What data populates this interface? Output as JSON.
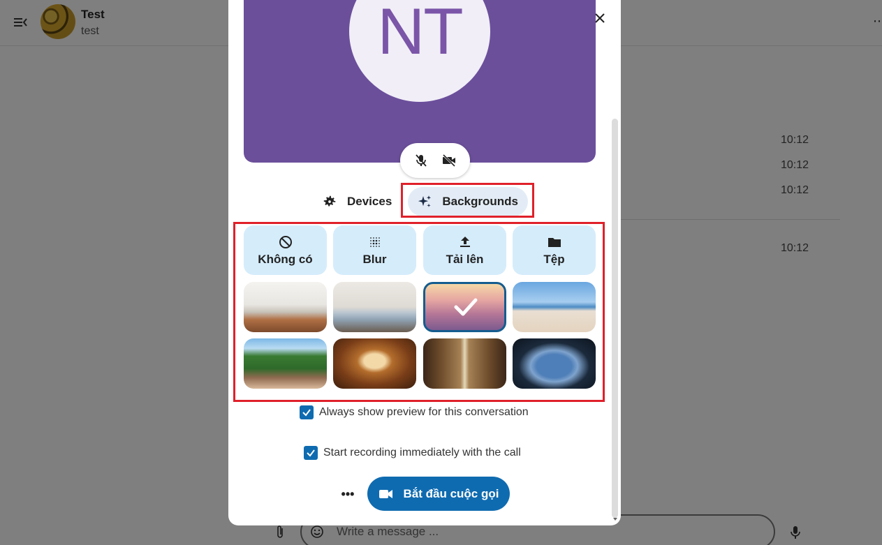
{
  "conversation": {
    "title": "Test",
    "subtitle": "test"
  },
  "messages": {
    "times": [
      "10:12",
      "10:12",
      "10:12",
      "10:12"
    ]
  },
  "composer": {
    "placeholder": "Write a message ..."
  },
  "preview": {
    "initials": "NT",
    "bg_color": "#6b4f9b"
  },
  "tabs": {
    "devices": "Devices",
    "backgrounds": "Backgrounds",
    "active": "backgrounds"
  },
  "backgrounds": {
    "options": [
      {
        "label": "Không có",
        "icon": "none-icon"
      },
      {
        "label": "Blur",
        "icon": "blur-icon"
      },
      {
        "label": "Tải lên",
        "icon": "upload-icon"
      },
      {
        "label": "Tệp",
        "icon": "folder-icon"
      }
    ],
    "images": [
      "office",
      "living-room",
      "pink-gradient",
      "beach",
      "garden",
      "theater",
      "library",
      "space-station"
    ],
    "selected": "pink-gradient"
  },
  "settings": {
    "always_preview": "Always show preview for this conversation",
    "start_recording": "Start recording immediately with the call"
  },
  "actions": {
    "more": "•••",
    "start_call": "Bắt đầu cuộc gọi"
  },
  "colors": {
    "accent": "#0f6bb0",
    "highlight": "#e0202a",
    "option_bg": "#d5ecfb"
  }
}
